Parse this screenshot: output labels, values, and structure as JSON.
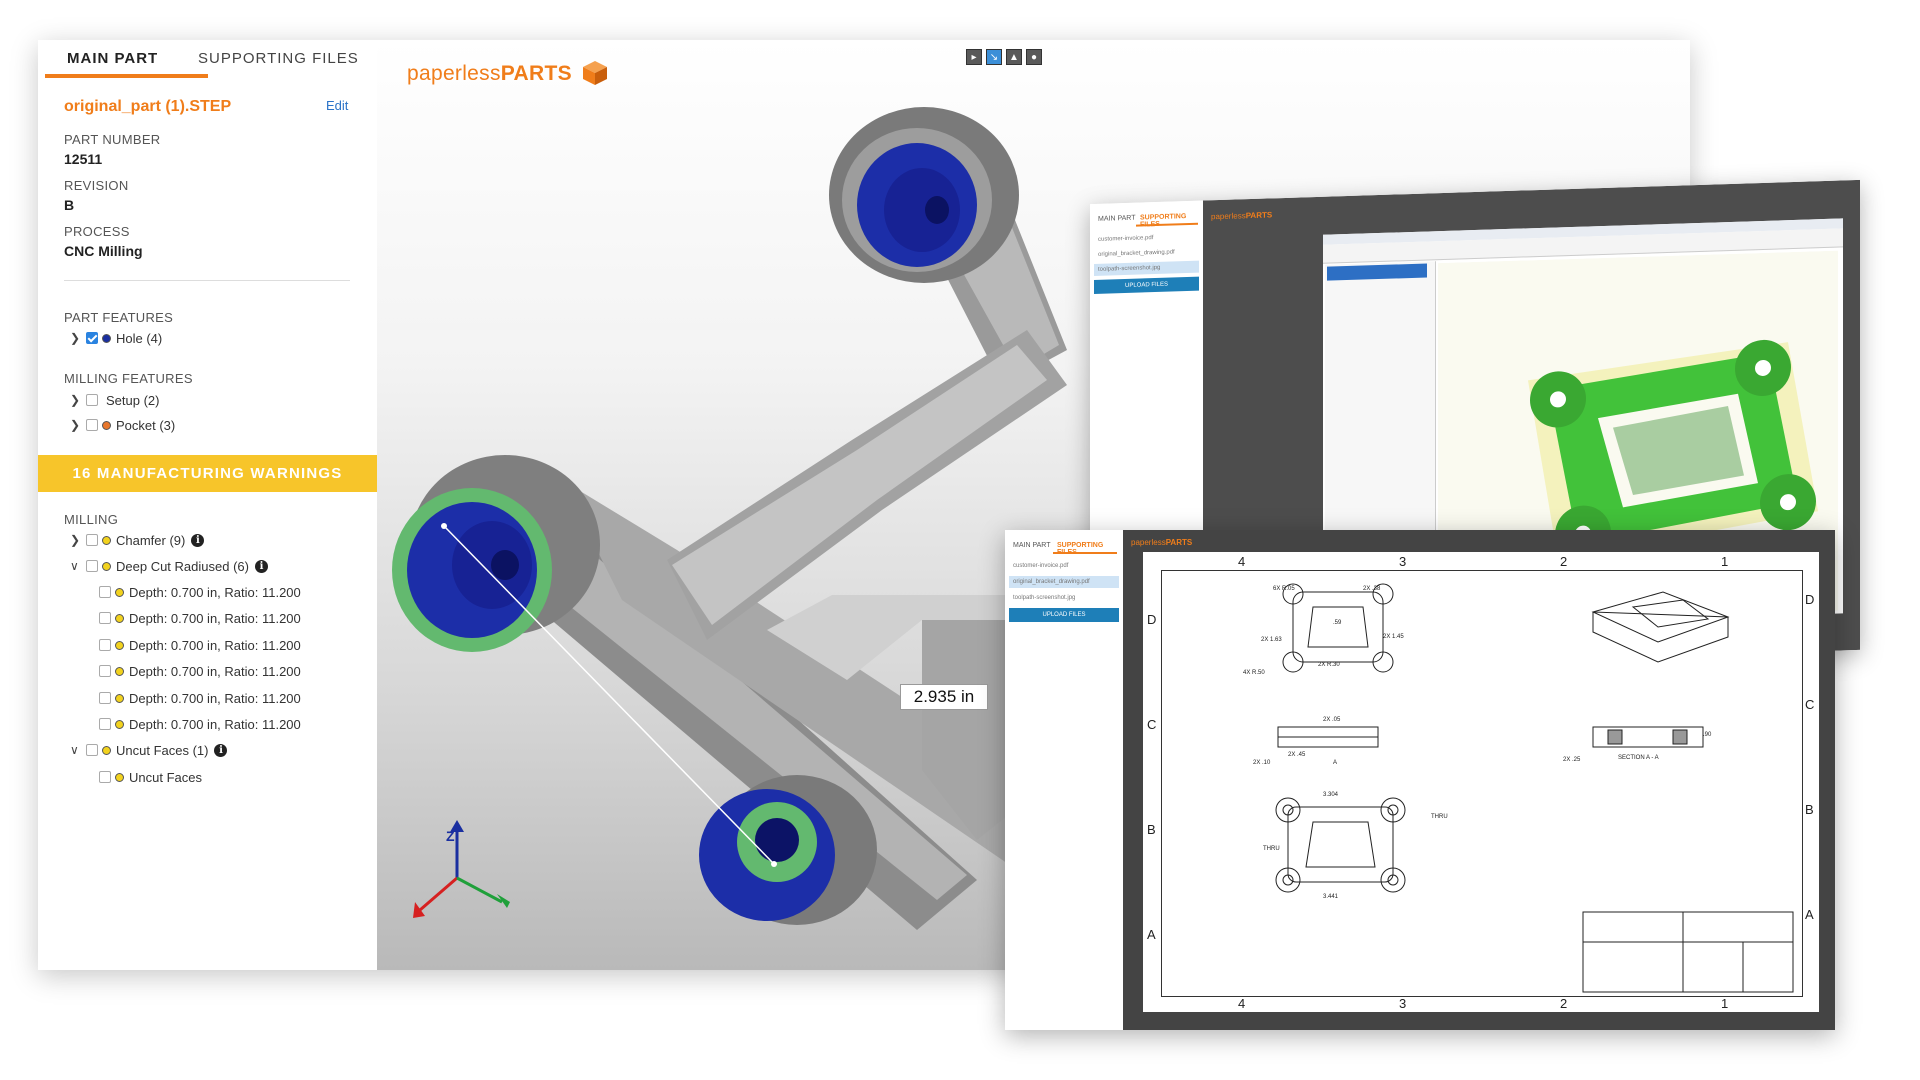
{
  "panel": {
    "tabs": [
      "MAIN PART",
      "SUPPORTING FILES"
    ],
    "filename": "original_part (1).STEP",
    "edit": "Edit",
    "part_number_label": "PART NUMBER",
    "part_number": "12511",
    "revision_label": "REVISION",
    "revision": "B",
    "process_label": "PROCESS",
    "process": "CNC Milling",
    "part_features_label": "PART FEATURES",
    "hole": "Hole (4)",
    "milling_features_label": "MILLING FEATURES",
    "setup": "Setup (2)",
    "pocket": "Pocket (3)",
    "warnings": "16 MANUFACTURING WARNINGS",
    "milling_label": "MILLING",
    "chamfer": "Chamfer (9)",
    "deep_cut": "Deep Cut Radiused (6)",
    "depth_items": [
      "Depth: 0.700 in, Ratio: 11.200",
      "Depth: 0.700 in, Ratio: 11.200",
      "Depth: 0.700 in, Ratio: 11.200",
      "Depth: 0.700 in, Ratio: 11.200",
      "Depth: 0.700 in, Ratio: 11.200",
      "Depth: 0.700 in, Ratio: 11.200"
    ],
    "uncut": "Uncut Faces (1)",
    "uncut_child": "Uncut Faces"
  },
  "viewer": {
    "logo_light": "paperless",
    "logo_bold": "PARTS",
    "measurement": "2.935 in",
    "axis_z": "Z",
    "tools": [
      "select-icon",
      "measure-icon",
      "section-icon",
      "settings-icon"
    ]
  },
  "cam_window": {
    "tabs": [
      "MAIN PART",
      "SUPPORTING FILES"
    ],
    "files": [
      "customer-invoice.pdf",
      "original_bracket_drawing.pdf",
      "toolpath-screenshot.jpg"
    ],
    "upload": "UPLOAD FILES",
    "logo_light": "paperless",
    "logo_bold": "PARTS"
  },
  "drawing_window": {
    "tabs": [
      "MAIN PART",
      "SUPPORTING FILES"
    ],
    "files": [
      "customer-invoice.pdf",
      "original_bracket_drawing.pdf",
      "toolpath-screenshot.jpg"
    ],
    "upload": "UPLOAD FILES",
    "logo_light": "paperless",
    "logo_bold": "PARTS",
    "zones_top": [
      "4",
      "3",
      "2",
      "1"
    ],
    "zones_side": [
      "D",
      "C",
      "B",
      "A"
    ],
    "dims": {
      "d1": "6X R.05",
      "d2": "2X .38",
      "d3": ".59",
      "d4": "2X 1.63",
      "d5": "2X 1.45",
      "d6": "2X R.30",
      "d7": "4X R.50",
      "d8": "2X .05",
      "d9": "2X .45",
      "d10": "2X .10",
      "d11": "A",
      "d12": "2X .25",
      "d13": "SECTION A - A",
      "d14": ".90",
      "d15": "3.304",
      "d16": "3.441",
      "d17": "THRU",
      "d18": "THRU"
    }
  },
  "colors": {
    "accent": "#f07d1a",
    "warning": "#f7c52a",
    "link": "#2a73c8",
    "hole": "#1a2fa0",
    "feature_green": "#5ec16a"
  }
}
